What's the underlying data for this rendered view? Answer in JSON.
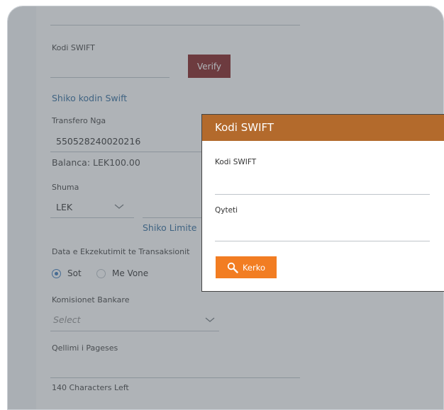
{
  "form": {
    "swift_label": "Kodi SWIFT",
    "verify_label": "Verify",
    "view_swift_link": "Shiko kodin Swift",
    "transfer_from_label": "Transfero Nga",
    "account_number": "550528240020216",
    "balance": "Balanca: LEK100.00",
    "amount_label": "Shuma",
    "currency": "LEK",
    "view_limits_link": "Shiko Limite",
    "execution_date_label": "Data e Ekzekutimit te Transaksionit",
    "radio_now": "Sot",
    "radio_later": "Me Vone",
    "fees_label": "Komisionet Bankare",
    "fees_placeholder": "Select",
    "purpose_label": "Qellimi i Pageses",
    "chars_left": "140 Characters Left"
  },
  "modal": {
    "title": "Kodi SWIFT",
    "swift_label": "Kodi SWIFT",
    "city_label": "Qyteti",
    "search_label": "Kerko"
  },
  "colors": {
    "verify_bg": "#7a0f0f",
    "modal_header": "#b36a2c",
    "search_button": "#f27d22",
    "link": "#1f5f95"
  }
}
